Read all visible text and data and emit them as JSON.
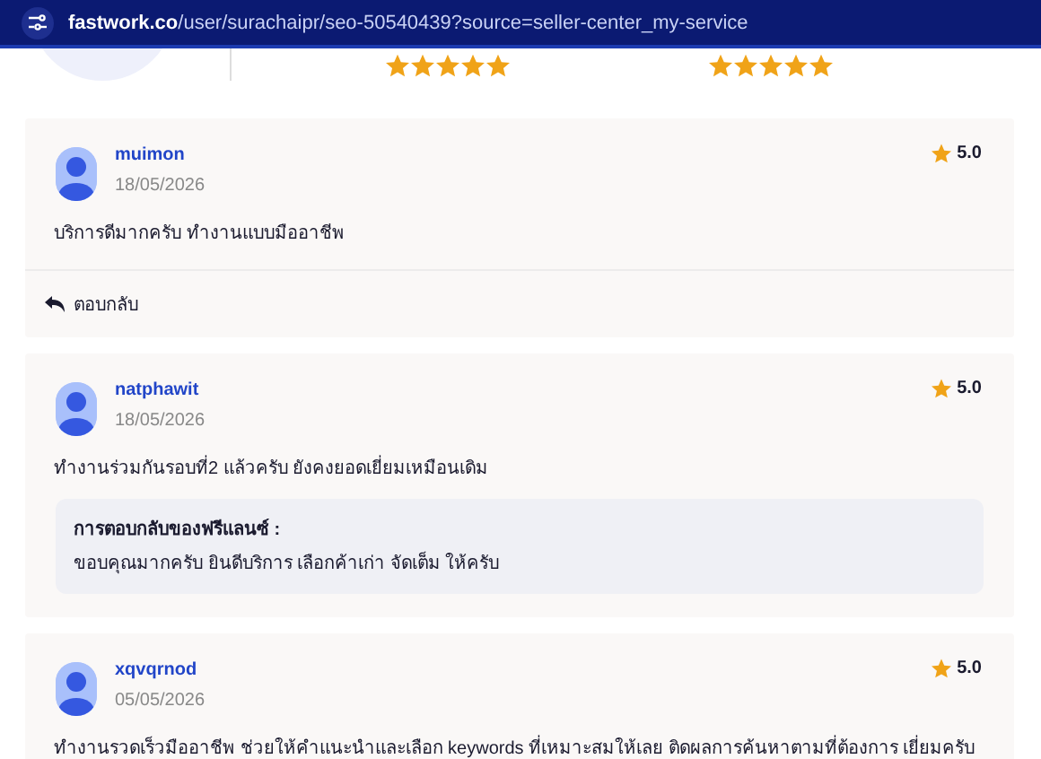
{
  "address_bar": {
    "domain": "fastwork.co",
    "path": "/user/surachaipr/seo-50540439?source=seller-center_my-service"
  },
  "summary": {
    "ratings": [
      {
        "stars": 5
      },
      {
        "stars": 5
      }
    ]
  },
  "reviews": [
    {
      "username": "muimon",
      "date": "18/05/2026",
      "rating": "5.0",
      "text": "บริการดีมากครับ ทำงานแบบมืออาชีพ",
      "reply_button": "ตอบกลับ"
    },
    {
      "username": "natphawit",
      "date": "18/05/2026",
      "rating": "5.0",
      "text": "ทำงานร่วมกันรอบที่2 แล้วครับ  ยังคงยอดเยี่ยมเหมือนเดิม",
      "freelancer_reply": {
        "title": "การตอบกลับของฟรีแลนซ์ :",
        "text": "ขอบคุณมากครับ ยินดีบริการ เลือกค้าเก่า จัดเต็ม ให้ครับ"
      }
    },
    {
      "username": "xqvqrnod",
      "date": "05/05/2026",
      "rating": "5.0",
      "text": "ทำงานรวดเร็วมืออาชีพ ช่วยให้คำแนะนำและเลือก keywords ที่เหมาะสมให้เลย ติดผลการค้นหาตามที่ต้องการ เยี่ยมครับ"
    }
  ]
}
